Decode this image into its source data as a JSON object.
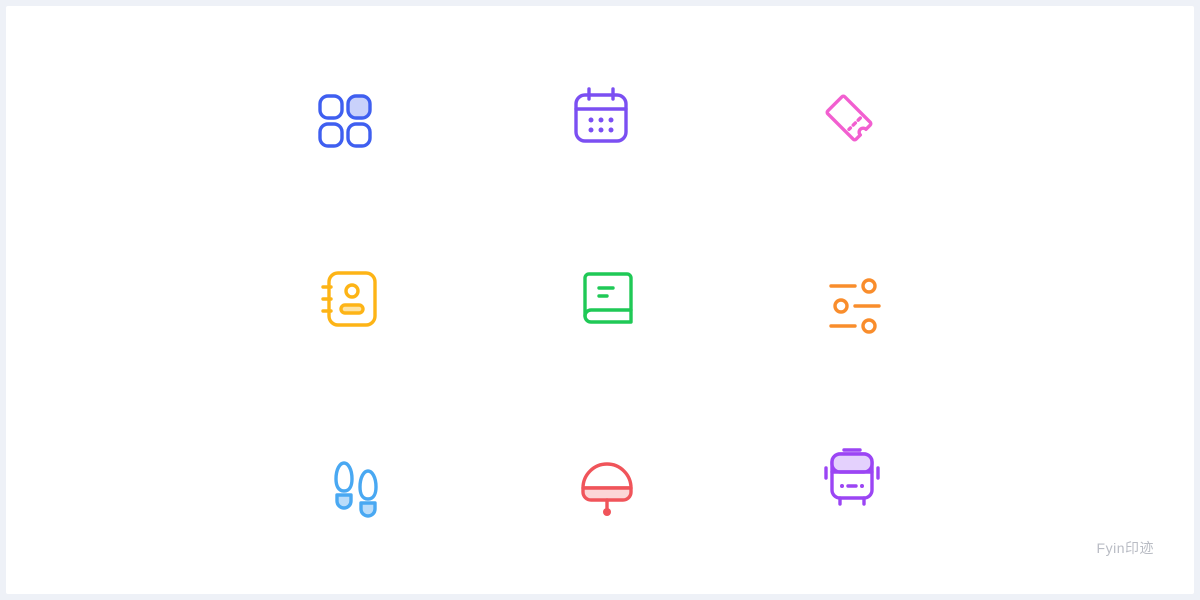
{
  "icons": [
    {
      "name": "grid-apps-icon",
      "color": "#3f5ff0"
    },
    {
      "name": "calendar-icon",
      "color": "#7b4ff2"
    },
    {
      "name": "ticket-icon",
      "color": "#f25fd0"
    },
    {
      "name": "contact-book-icon",
      "color": "#fdb416"
    },
    {
      "name": "book-icon",
      "color": "#1fc956"
    },
    {
      "name": "sliders-settings-icon",
      "color": "#f98d2c"
    },
    {
      "name": "footprints-icon",
      "color": "#49a8f2"
    },
    {
      "name": "service-bell-icon",
      "color": "#f0545a"
    },
    {
      "name": "bus-icon",
      "color": "#9b45f4"
    }
  ],
  "watermark": "Fyin印迹"
}
